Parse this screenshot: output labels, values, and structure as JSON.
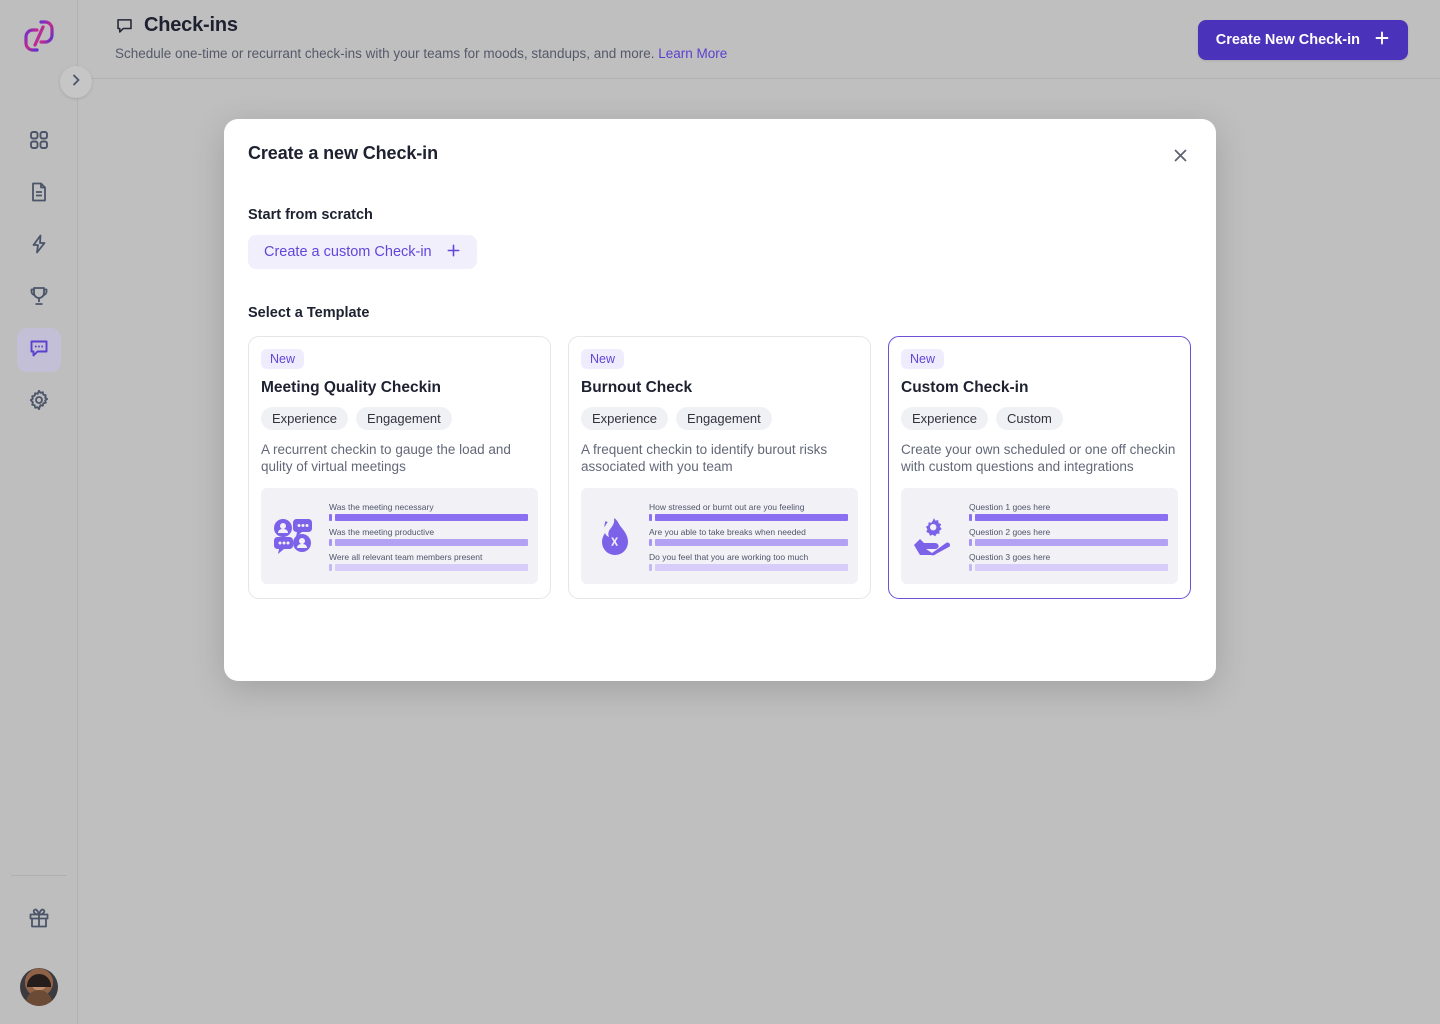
{
  "sidebar": {
    "logo_name": "logo-mark",
    "items": [
      {
        "id": "dashboard",
        "icon": "grid-icon",
        "active": false
      },
      {
        "id": "documents",
        "icon": "document-icon",
        "active": false
      },
      {
        "id": "pulse",
        "icon": "lightning-icon",
        "active": false
      },
      {
        "id": "recognition",
        "icon": "trophy-icon",
        "active": false
      },
      {
        "id": "check-ins",
        "icon": "chat-bubble-icon",
        "active": true
      },
      {
        "id": "settings",
        "icon": "gear-icon",
        "active": false
      }
    ],
    "gift_icon": "gift-icon",
    "avatar_name": "user-avatar",
    "collapse_icon": "chevron-right-icon"
  },
  "header": {
    "icon": "chat-bubble-icon",
    "title": "Check-ins",
    "subtitle": "Schedule one-time or recurrant check-ins with your teams for moods, standups, and more.",
    "learn_more": "Learn More",
    "create_button": "Create New Check-in",
    "create_button_icon": "plus-icon",
    "accent_color": "#4b32ba"
  },
  "modal": {
    "title": "Create a new Check-in",
    "close_icon": "close-icon",
    "scratch_label": "Start from scratch",
    "scratch_button": "Create a custom Check-in",
    "scratch_button_icon": "plus-icon",
    "template_label": "Select a Template",
    "templates": [
      {
        "badge": "New",
        "title": "Meeting Quality Checkin",
        "tags": [
          "Experience",
          "Engagement"
        ],
        "description": "A recurrent checkin to gauge the load and qulity of virtual meetings",
        "icon": "people-chat-icon",
        "selected": false,
        "preview_questions": [
          "Was the meeting necessary",
          "Was the meeting productive",
          "Were all relevant team members present"
        ]
      },
      {
        "badge": "New",
        "title": "Burnout Check",
        "tags": [
          "Experience",
          "Engagement"
        ],
        "description": "A frequent checkin to identify burout risks associated with you team",
        "icon": "flame-icon",
        "selected": false,
        "preview_questions": [
          "How stressed or burnt out are you feeling",
          "Are you able to take breaks when needed",
          "Do you feel that you are working too much"
        ]
      },
      {
        "badge": "New",
        "title": "Custom Check-in",
        "tags": [
          "Experience",
          "Custom"
        ],
        "description": "Create your own scheduled or one off checkin with custom questions and integrations",
        "icon": "gear-hand-icon",
        "selected": true,
        "preview_questions": [
          "Question 1 goes here",
          "Question 2 goes here",
          "Question 3 goes here"
        ]
      }
    ]
  },
  "colors": {
    "brand_purple": "#4b32ba",
    "accent_light": "#6246d8",
    "preview_bar": "#8a6ff0",
    "overlay": "#bfbfbf"
  }
}
